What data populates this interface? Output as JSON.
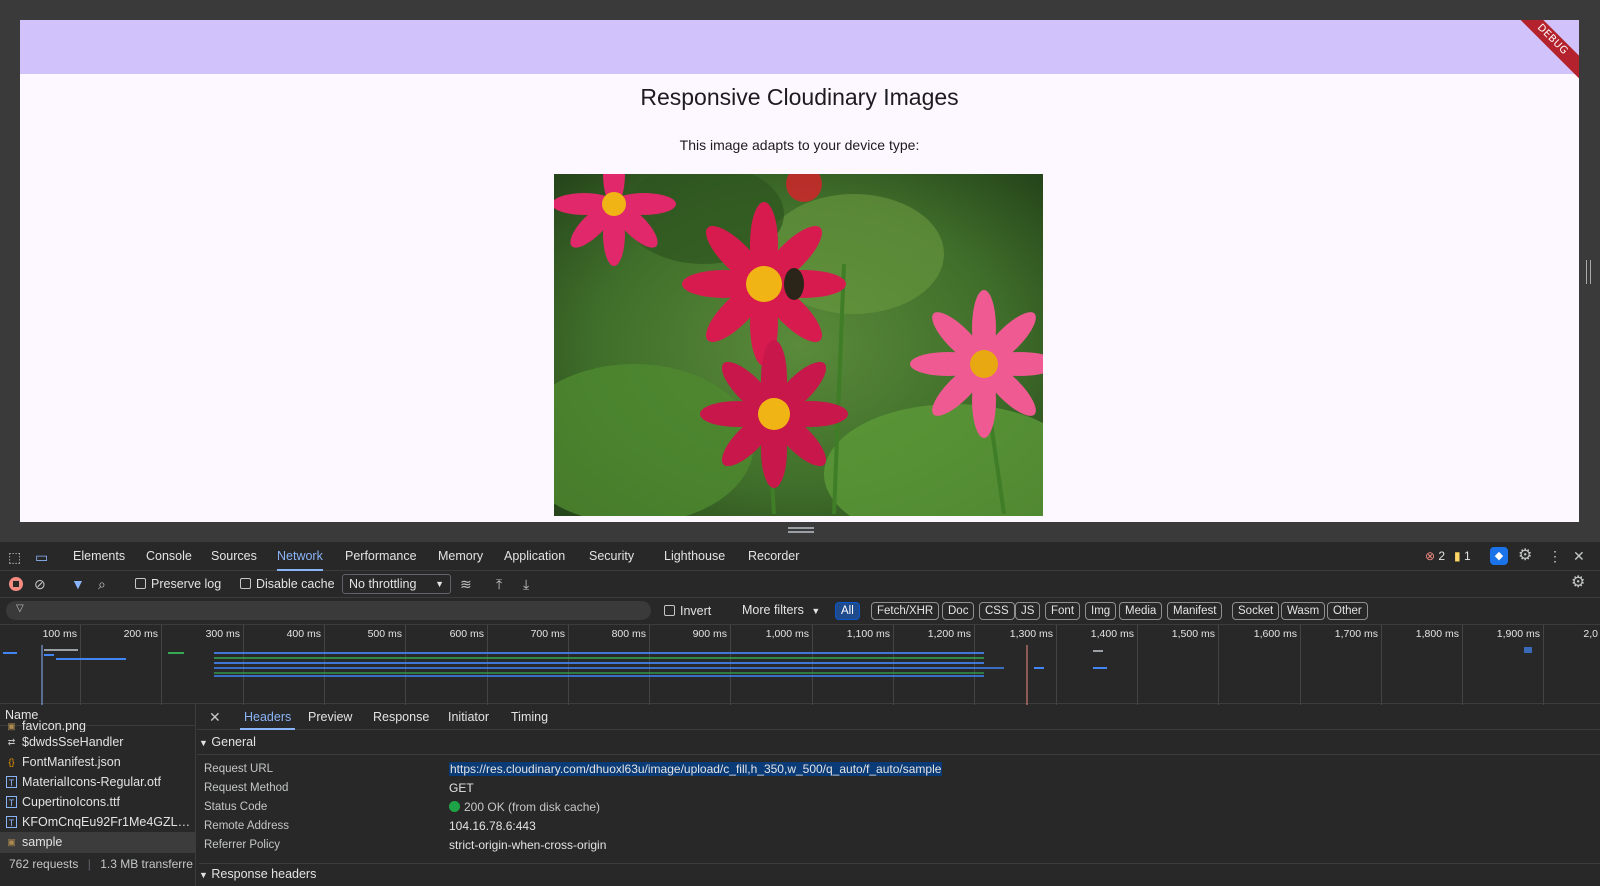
{
  "app": {
    "debug_label": "DEBUG",
    "title": "Responsive Cloudinary Images",
    "subtitle": "This image adapts to your device type:"
  },
  "devtools": {
    "tabs": [
      "Elements",
      "Console",
      "Sources",
      "Network",
      "Performance",
      "Memory",
      "Application",
      "Security",
      "Lighthouse",
      "Recorder"
    ],
    "active_tab": "Network",
    "errors_count": "2",
    "warnings_count": "1",
    "toolbar": {
      "preserve_log": "Preserve log",
      "disable_cache": "Disable cache",
      "throttling": "No throttling"
    },
    "filter": {
      "invert": "Invert",
      "more_filters": "More filters",
      "chips": [
        "All",
        "Fetch/XHR",
        "Doc",
        "CSS",
        "JS",
        "Font",
        "Img",
        "Media",
        "Manifest",
        "Socket",
        "Wasm",
        "Other"
      ]
    },
    "timeline_ticks": [
      "100 ms",
      "200 ms",
      "300 ms",
      "400 ms",
      "500 ms",
      "600 ms",
      "700 ms",
      "800 ms",
      "900 ms",
      "1,000 ms",
      "1,100 ms",
      "1,200 ms",
      "1,300 ms",
      "1,400 ms",
      "1,500 ms",
      "1,600 ms",
      "1,700 ms",
      "1,800 ms",
      "1,900 ms",
      "2,0"
    ],
    "requests": {
      "header": "Name",
      "rows": [
        {
          "name": "favicon.png",
          "icon": "image-file-icon"
        },
        {
          "name": "$dwdsSseHandler",
          "icon": "eventsource-icon"
        },
        {
          "name": "FontManifest.json",
          "icon": "json-file-icon"
        },
        {
          "name": "MaterialIcons-Regular.otf",
          "icon": "font-file-icon"
        },
        {
          "name": "CupertinoIcons.ttf",
          "icon": "font-file-icon"
        },
        {
          "name": "KFOmCnqEu92Fr1Me4GZLC...",
          "icon": "font-file-icon"
        },
        {
          "name": "sample",
          "icon": "image-file-icon"
        }
      ],
      "count": "762 requests",
      "transferred": "1.3 MB transferre"
    },
    "detail": {
      "tabs": [
        "Headers",
        "Preview",
        "Response",
        "Initiator",
        "Timing"
      ],
      "active_tab": "Headers",
      "general_title": "General",
      "general": [
        {
          "key": "Request URL",
          "value": "https://res.cloudinary.com/dhuoxl63u/image/upload/c_fill,h_350,w_500/q_auto/f_auto/sample"
        },
        {
          "key": "Request Method",
          "value": "GET"
        },
        {
          "key": "Status Code",
          "value": "200 OK (from disk cache)"
        },
        {
          "key": "Remote Address",
          "value": "104.16.78.6:443"
        },
        {
          "key": "Referrer Policy",
          "value": "strict-origin-when-cross-origin"
        }
      ],
      "response_headers_title": "Response headers"
    }
  }
}
